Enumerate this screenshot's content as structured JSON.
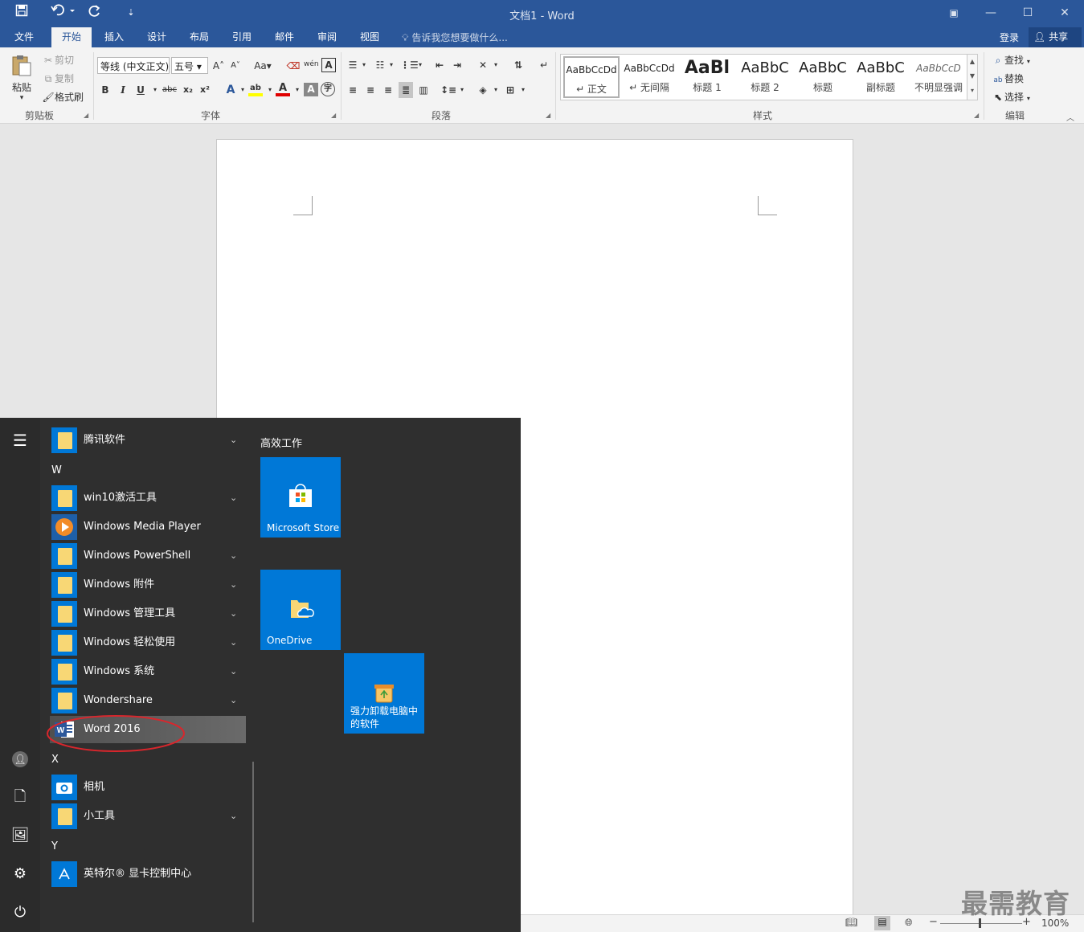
{
  "window": {
    "title": "文档1 - Word",
    "controls": {
      "ribbon_display": "▣",
      "minimize": "—",
      "maximize": "☐",
      "close": "✕"
    }
  },
  "quick_access": {
    "save": "save-icon",
    "undo": "undo-icon",
    "redo": "redo-icon",
    "customize": "customize-icon"
  },
  "tabs": [
    {
      "label": "文件",
      "active": false
    },
    {
      "label": "开始",
      "active": true
    },
    {
      "label": "插入",
      "active": false
    },
    {
      "label": "设计",
      "active": false
    },
    {
      "label": "布局",
      "active": false
    },
    {
      "label": "引用",
      "active": false
    },
    {
      "label": "邮件",
      "active": false
    },
    {
      "label": "审阅",
      "active": false
    },
    {
      "label": "视图",
      "active": false
    }
  ],
  "tellme": {
    "placeholder": "告诉我您想要做什么..."
  },
  "account": {
    "login": "登录",
    "share": "共享"
  },
  "clipboard": {
    "paste": "粘贴",
    "cut": "剪切",
    "copy": "复制",
    "format_painter": "格式刷",
    "group_label": "剪贴板"
  },
  "font": {
    "family": "等线 (中文正文)",
    "size": "五号",
    "grow": "A",
    "shrink": "A",
    "case": "Aa",
    "pinyin": "wén",
    "border_char": "A",
    "bold": "B",
    "italic": "I",
    "underline": "U",
    "strike": "abc",
    "subscript": "x₂",
    "superscript": "x²",
    "effects": "A",
    "highlight": "ab",
    "color": "A",
    "shade": "A",
    "enclose": "字",
    "group_label": "字体"
  },
  "paragraph": {
    "group_label": "段落"
  },
  "styles": {
    "items": [
      {
        "sample": "AaBbCcDd",
        "name": "↵ 正文"
      },
      {
        "sample": "AaBbCcDd",
        "name": "↵ 无间隔"
      },
      {
        "sample": "AaBl",
        "name": "标题 1"
      },
      {
        "sample": "AaBbC",
        "name": "标题 2"
      },
      {
        "sample": "AaBbC",
        "name": "标题"
      },
      {
        "sample": "AaBbC",
        "name": "副标题"
      },
      {
        "sample": "AaBbCcD",
        "name": "不明显强调"
      }
    ],
    "group_label": "样式"
  },
  "editing": {
    "find": "查找",
    "replace": "替换",
    "select": "选择",
    "group_label": "编辑"
  },
  "status": {
    "zoom": "100%",
    "zoom_minus": "−",
    "zoom_plus": "+"
  },
  "start_menu": {
    "apps": [
      {
        "label": "腾讯软件",
        "type": "folder",
        "chevron": true
      },
      {
        "label": "W",
        "type": "letter"
      },
      {
        "label": "win10激活工具",
        "type": "folder",
        "chevron": true
      },
      {
        "label": "Windows Media Player",
        "type": "wmp",
        "chevron": false
      },
      {
        "label": "Windows PowerShell",
        "type": "folder",
        "chevron": true
      },
      {
        "label": "Windows 附件",
        "type": "folder",
        "chevron": true
      },
      {
        "label": "Windows 管理工具",
        "type": "folder",
        "chevron": true
      },
      {
        "label": "Windows 轻松使用",
        "type": "folder",
        "chevron": true
      },
      {
        "label": "Windows 系统",
        "type": "folder",
        "chevron": true
      },
      {
        "label": "Wondershare",
        "type": "folder",
        "chevron": true
      },
      {
        "label": "Word 2016",
        "type": "word",
        "chevron": false,
        "highlighted": true
      },
      {
        "label": "X",
        "type": "letter"
      },
      {
        "label": "相机",
        "type": "camera",
        "chevron": false
      },
      {
        "label": "小工具",
        "type": "folder",
        "chevron": true
      },
      {
        "label": "Y",
        "type": "letter"
      },
      {
        "label": "英特尔® 显卡控制中心",
        "type": "intel",
        "chevron": false
      }
    ],
    "tiles_group": "高效工作",
    "tiles": [
      {
        "name": "Microsoft Store",
        "icon": "store-icon"
      },
      {
        "name": "OneDrive",
        "icon": "onedrive-icon"
      },
      {
        "name": "强力卸载电脑中的软件",
        "icon": "uninstall-icon"
      }
    ]
  },
  "watermark": "最需教育",
  "colors": {
    "word_blue": "#2b579a",
    "tile_blue": "#0078d7",
    "start_bg": "#2f2f2f",
    "highlight_ring": "#d9262c"
  }
}
